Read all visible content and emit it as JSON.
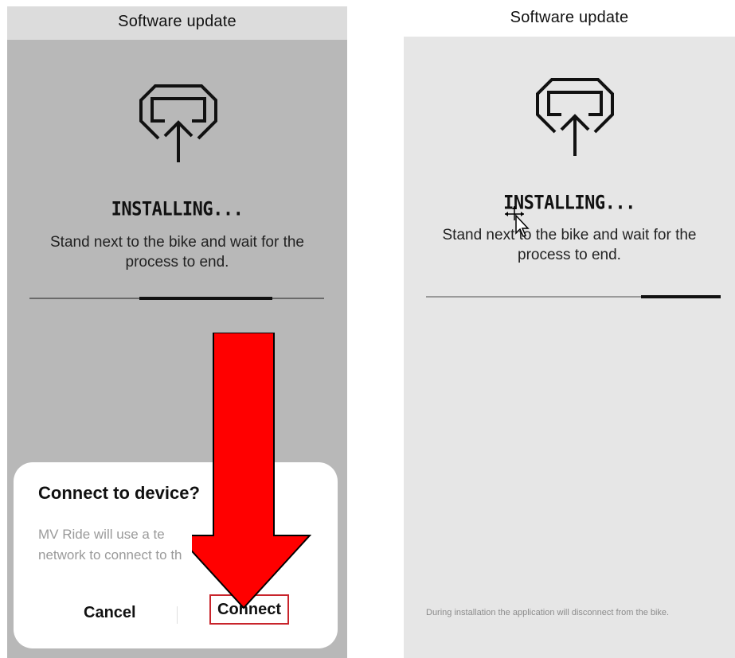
{
  "left_screen": {
    "title": "Software update",
    "icon": "upload-to-device-icon",
    "status": "INSTALLING...",
    "description": "Stand next to the bike and wait for the process to end.",
    "progress": 0.45,
    "dialog": {
      "title": "Connect to device?",
      "message_line1": "MV Ride will use a te",
      "message_line2": "network to connect to th",
      "cancel_label": "Cancel",
      "connect_label": "Connect"
    },
    "overlay_arrow": "down-arrow-annotation",
    "colors": {
      "arrow": "#ff0000",
      "highlight": "#c8242b"
    }
  },
  "right_screen": {
    "title": "Software update",
    "icon": "upload-to-device-icon",
    "status": "INSTALLING...",
    "description": "Stand next to the bike and wait for the process to end.",
    "progress": 0.27,
    "footnote": "During installation the application will disconnect from the bike."
  }
}
